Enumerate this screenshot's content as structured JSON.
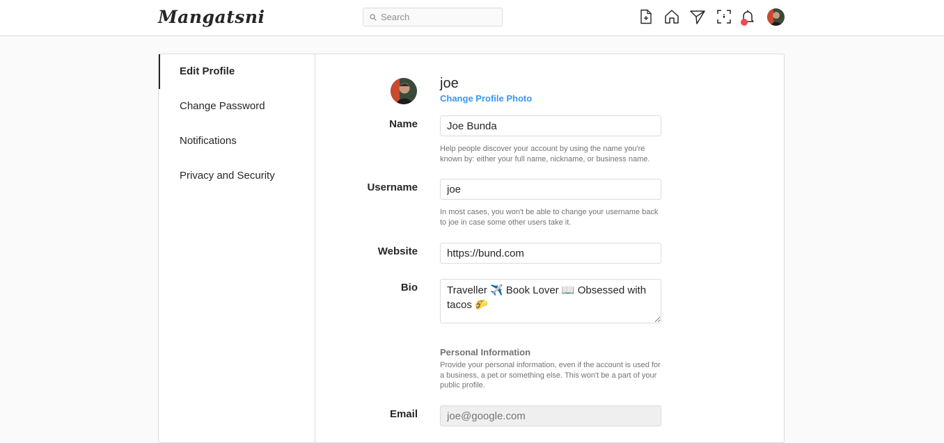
{
  "app": {
    "logo": "Mangatsni"
  },
  "search": {
    "placeholder": "Search"
  },
  "nav": {
    "icons": [
      "new-post-icon",
      "home-icon",
      "direct-icon",
      "explore-icon",
      "notifications-icon"
    ],
    "notification_dot_color": "#ed4956"
  },
  "sidebar": {
    "items": [
      {
        "label": "Edit Profile",
        "active": true
      },
      {
        "label": "Change Password",
        "active": false
      },
      {
        "label": "Notifications",
        "active": false
      },
      {
        "label": "Privacy and Security",
        "active": false
      }
    ]
  },
  "profile": {
    "username": "joe",
    "change_photo": "Change Profile Photo"
  },
  "form": {
    "name": {
      "label": "Name",
      "value": "Joe Bunda",
      "help": "Help people discover your account by using the name you're known by: either your full name, nickname, or business name."
    },
    "username": {
      "label": "Username",
      "value": "joe",
      "help": "In most cases, you won't be able to change your username back to joe in case some other users take it."
    },
    "website": {
      "label": "Website",
      "value": "https://bund.com"
    },
    "bio": {
      "label": "Bio",
      "value": "Traveller ✈️ Book Lover 📖 Obsessed with tacos 🌮"
    },
    "personal": {
      "title": "Personal Information",
      "help": "Provide your personal information, even if the account is used for a business, a pet or something else. This won't be a part of your public profile."
    },
    "email": {
      "label": "Email",
      "value": "joe@google.com"
    }
  },
  "colors": {
    "link": "#3897f0",
    "border": "#dbdbdb",
    "background": "#fafafa"
  }
}
